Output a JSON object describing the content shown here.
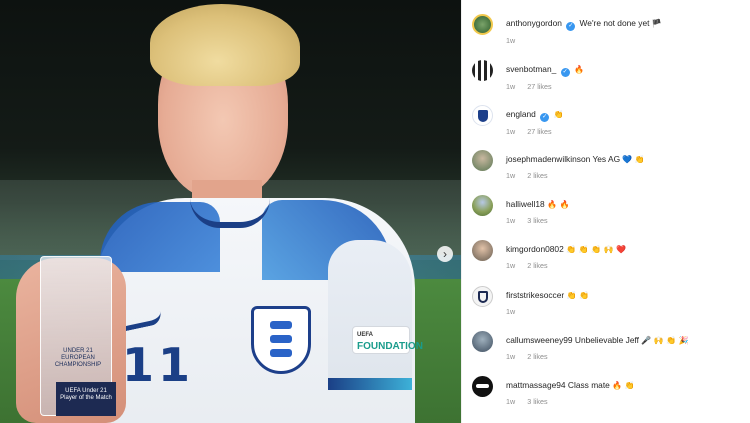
{
  "photo": {
    "shirt_number": "11",
    "sleeve_patch_small": "UEFA",
    "sleeve_patch_text": "FOUNDATION",
    "trophy_text": "UNDER 21 EUROPEAN CHAMPIONSHIP",
    "trophy_base": "UEFA Under 21 Player of the Match",
    "next_icon": "›"
  },
  "post": {
    "author": "anthonygordon",
    "caption": "We're not done yet",
    "caption_emoji": "🏴",
    "time": "1w"
  },
  "comments": [
    {
      "user": "svenbotman_",
      "verified": true,
      "text": "",
      "emoji": "🔥",
      "time": "1w",
      "likes": "27 likes",
      "avatar_color": "#2a2a2a"
    },
    {
      "user": "england",
      "verified": true,
      "text": "",
      "emoji": "👏",
      "time": "1w",
      "likes": "27 likes",
      "avatar_color": "#e8eef8"
    },
    {
      "user": "josephmadenwilkinson",
      "verified": false,
      "text": "Yes AG",
      "emoji": "💙 👏",
      "time": "1w",
      "likes": "2 likes",
      "avatar_color": "#7a8a6a"
    },
    {
      "user": "halliwell18",
      "verified": false,
      "text": "",
      "emoji": "🔥 🔥",
      "time": "1w",
      "likes": "3 likes",
      "avatar_color": "#6a8a4a"
    },
    {
      "user": "kimgordon0802",
      "verified": false,
      "text": "",
      "emoji": "👏 👏 👏 🙌 ❤️",
      "time": "1w",
      "likes": "2 likes",
      "avatar_color": "#8a7a6a"
    },
    {
      "user": "firststrikesoccer",
      "verified": false,
      "text": "",
      "emoji": "👏 👏",
      "time": "1w",
      "likes": "",
      "avatar_color": "#f0f0f0"
    },
    {
      "user": "callumsweeney99",
      "verified": false,
      "text": "Unbelievable Jeff",
      "emoji": "🎤 🙌 👏 🎉",
      "time": "1w",
      "likes": "2 likes",
      "avatar_color": "#5a6a7a"
    },
    {
      "user": "mattmassage94",
      "verified": false,
      "text": "Class mate",
      "emoji": "🔥 👏",
      "time": "1w",
      "likes": "3 likes",
      "avatar_color": "#111111"
    }
  ],
  "colors": {
    "verified": "#3897f0",
    "meta_gray": "#8e8e8e",
    "text": "#262626"
  }
}
